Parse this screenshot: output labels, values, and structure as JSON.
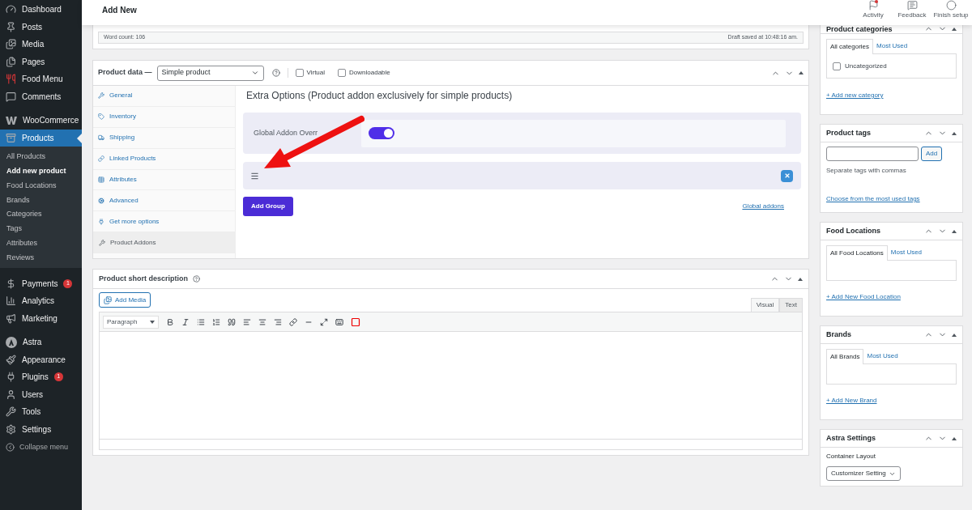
{
  "sidebar": {
    "groups": [
      [
        {
          "label": "Dashboard",
          "selected": false
        },
        {
          "label": "Posts",
          "selected": false
        },
        {
          "label": "Media",
          "selected": false
        },
        {
          "label": "Pages",
          "selected": false
        },
        {
          "label": "Food Menu",
          "selected": false
        },
        {
          "label": "Comments",
          "selected": false
        }
      ],
      [
        {
          "label": "WooCommerce",
          "selected": false
        },
        {
          "label": "Products",
          "selected": true,
          "children": [
            {
              "label": "All Products",
              "selected": false
            },
            {
              "label": "Add new product",
              "selected": true
            },
            {
              "label": "Food Locations",
              "selected": false
            },
            {
              "label": "Brands",
              "selected": false
            },
            {
              "label": "Categories",
              "selected": false
            },
            {
              "label": "Tags",
              "selected": false
            },
            {
              "label": "Attributes",
              "selected": false
            },
            {
              "label": "Reviews",
              "selected": false
            }
          ]
        }
      ],
      [
        {
          "label": "Payments",
          "selected": false,
          "badge": "1"
        },
        {
          "label": "Analytics",
          "selected": false
        },
        {
          "label": "Marketing",
          "selected": false
        }
      ],
      [
        {
          "label": "Astra",
          "selected": false
        },
        {
          "label": "Appearance",
          "selected": false
        },
        {
          "label": "Plugins",
          "selected": false,
          "badge": "1"
        },
        {
          "label": "Users",
          "selected": false
        },
        {
          "label": "Tools",
          "selected": false
        },
        {
          "label": "Settings",
          "selected": false
        }
      ]
    ],
    "collapse_label": "Collapse menu"
  },
  "header": {
    "title": "Add New",
    "actions": [
      {
        "label": "Activity",
        "notification": true
      },
      {
        "label": "Feedback",
        "notification": false
      },
      {
        "label": "Finish setup",
        "notification": false
      }
    ]
  },
  "editor_status": {
    "word_count": "Word count: 106",
    "saved": "Draft saved at 10:48:16 am."
  },
  "product_data": {
    "title": "Product data —",
    "type_select": "Simple product",
    "options": [
      {
        "label": "Virtual",
        "checked": false
      },
      {
        "label": "Downloadable",
        "checked": false
      }
    ],
    "tabs": [
      {
        "label": "General",
        "selected": false
      },
      {
        "label": "Inventory",
        "selected": false
      },
      {
        "label": "Shipping",
        "selected": false
      },
      {
        "label": "Linked Products",
        "selected": false
      },
      {
        "label": "Attributes",
        "selected": false
      },
      {
        "label": "Advanced",
        "selected": false
      },
      {
        "label": "Get more options",
        "selected": false
      },
      {
        "label": "Product Addons",
        "selected": true
      }
    ],
    "heading": "Extra Options (Product addon exclusively for simple products)",
    "override_label": "Global Addon Overr",
    "override_on": true,
    "add_group": "Add Group",
    "global_link": "Global addons"
  },
  "short_description": {
    "title": "Product short description",
    "add_media": "Add Media",
    "editor_tabs": [
      {
        "label": "Visual",
        "selected": true
      },
      {
        "label": "Text",
        "selected": false
      }
    ],
    "format": "Paragraph"
  },
  "right": {
    "categories": {
      "title": "Product categories",
      "tabs": [
        {
          "label": "All categories",
          "selected": true
        },
        {
          "label": "Most Used",
          "selected": false
        }
      ],
      "items": [
        {
          "label": "Uncategorized",
          "checked": false
        }
      ],
      "link": "+ Add new category"
    },
    "tags": {
      "title": "Product tags",
      "button": "Add",
      "hint": "Separate tags with commas",
      "link": "Choose from the most used tags"
    },
    "locations": {
      "title": "Food Locations",
      "tabs": [
        {
          "label": "All Food Locations",
          "selected": true
        },
        {
          "label": "Most Used",
          "selected": false
        }
      ],
      "link": "+ Add New Food Location"
    },
    "brands": {
      "title": "Brands",
      "tabs": [
        {
          "label": "All Brands",
          "selected": true
        },
        {
          "label": "Most Used",
          "selected": false
        }
      ],
      "link": "+ Add New Brand"
    },
    "astra": {
      "title": "Astra Settings",
      "label": "Container Layout",
      "select": "Customizer Setting"
    }
  }
}
